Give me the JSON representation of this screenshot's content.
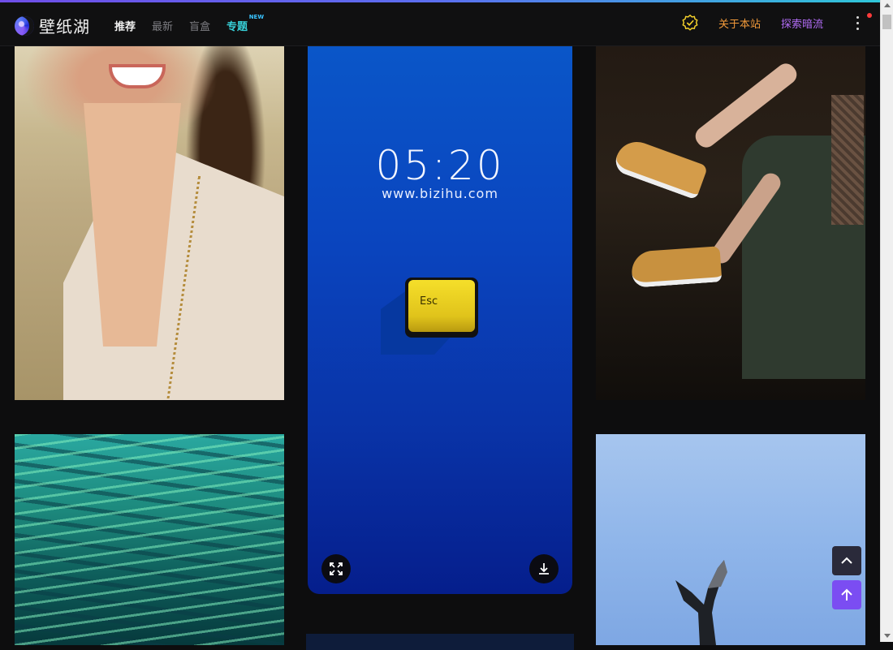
{
  "header": {
    "logo_text": "壁纸湖",
    "nav": [
      {
        "label": "推荐",
        "state": "active"
      },
      {
        "label": "最新",
        "state": "normal"
      },
      {
        "label": "盲盒",
        "state": "normal"
      },
      {
        "label": "专题",
        "state": "special",
        "badge": "NEW"
      }
    ],
    "verify_icon": "verified-badge-icon",
    "about_label": "关于本站",
    "dark_label": "探索暗流",
    "more_icon": "more-vertical-icon"
  },
  "wallpapers": {
    "featured": {
      "clock": "05:20",
      "site": "www.bizihu.com",
      "key_label": "Esc",
      "expand_icon": "expand-icon",
      "download_icon": "download-icon"
    }
  },
  "floating": {
    "up_icon": "chevron-up-icon",
    "top_icon": "arrow-up-icon"
  },
  "colors": {
    "accent_gradient": [
      "#6f4ee8",
      "#2fc6d8"
    ],
    "about": "#f29a3a",
    "dark": "#b16cf5",
    "special_nav": "#37d0d8",
    "top_button": "#7b4df2"
  }
}
